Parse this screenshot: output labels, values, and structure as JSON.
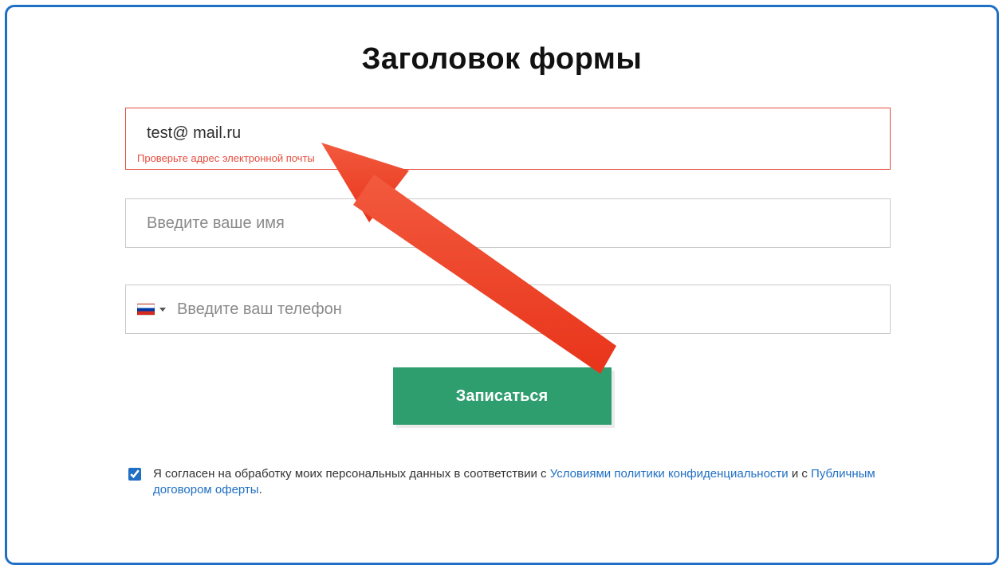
{
  "title": "Заголовок формы",
  "email": {
    "value": "test@ mail.ru",
    "placeholder": "",
    "error": "Проверьте адрес электронной почты"
  },
  "name": {
    "value": "",
    "placeholder": "Введите ваше имя"
  },
  "phone": {
    "value": "",
    "placeholder": "Введите ваш телефон",
    "flag": "ru"
  },
  "submit_label": "Записаться",
  "consent": {
    "checked": true,
    "text_prefix": "Я согласен на обработку моих персональных данных в соответствии с ",
    "link1": "Условиями политики конфиденциальности",
    "text_mid": " и с ",
    "link2": "Публичным договором оферты",
    "text_suffix": "."
  },
  "colors": {
    "frame_border": "#1f6fc4",
    "error": "#e74c3c",
    "submit_bg": "#2f9e6f",
    "link": "#1f6fc4",
    "arrow": "#ef4730"
  }
}
